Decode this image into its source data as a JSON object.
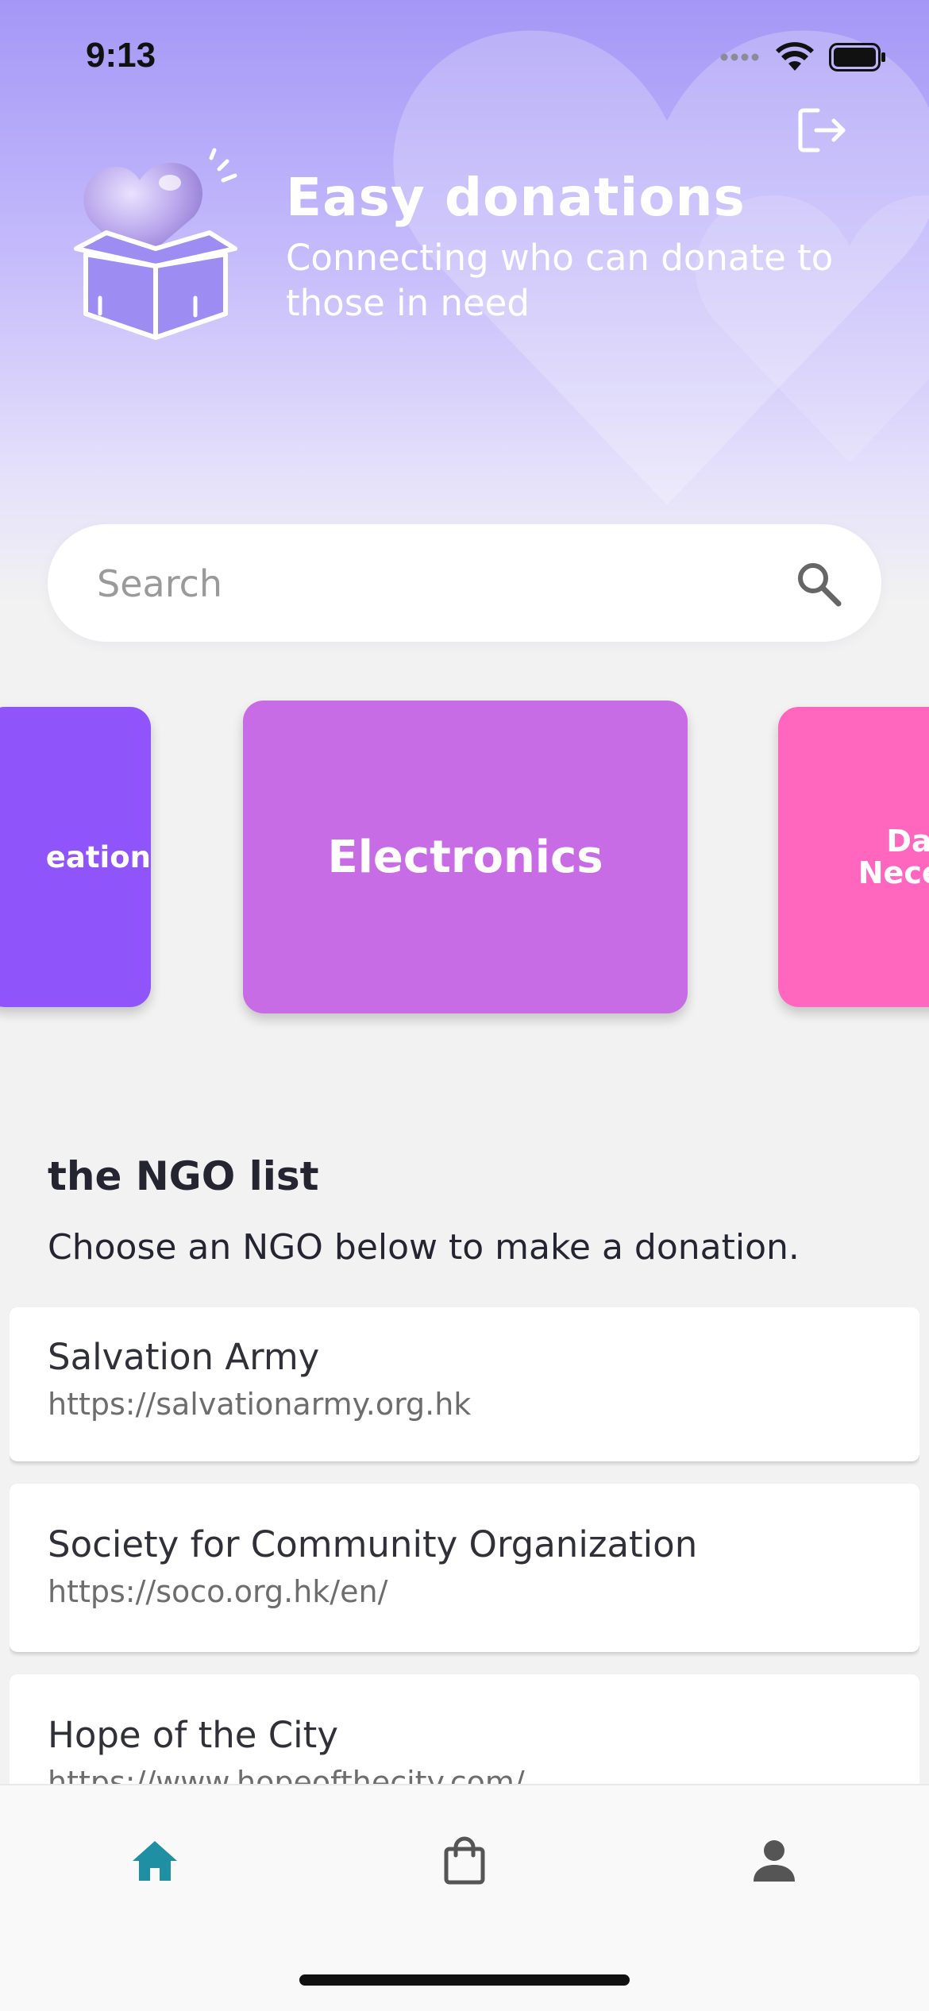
{
  "status_bar": {
    "time": "9:13"
  },
  "header": {
    "title": "Easy donations",
    "subtitle": "Connecting who can donate to those in need",
    "logout_icon": "logout-icon",
    "logo_icon": "heart-in-box-logo"
  },
  "search": {
    "placeholder": "Search",
    "value": "",
    "icon": "search-icon"
  },
  "categories": [
    {
      "label": "Education",
      "visible_text": "eation",
      "color": "#8f55fb"
    },
    {
      "label": "Electronics",
      "visible_text": "Electronics",
      "color": "#c86ce6"
    },
    {
      "label": "Daily Necessities",
      "visible_text": "Da Neces",
      "color": "#ff67bf"
    }
  ],
  "ngo_section": {
    "heading": "the NGO list",
    "instructions": "Choose an NGO below to make a donation.",
    "items": [
      {
        "name": "Salvation Army",
        "url": "https://salvationarmy.org.hk"
      },
      {
        "name": "Society for Community Organization",
        "url": "https://soco.org.hk/en/"
      },
      {
        "name": "Hope of the City",
        "url": "https://www.hopeofthecity.com/"
      }
    ]
  },
  "bottom_nav": {
    "items": [
      {
        "id": "home",
        "icon": "home-icon",
        "active": true
      },
      {
        "id": "donations",
        "icon": "shopping-bag-icon",
        "active": false
      },
      {
        "id": "profile",
        "icon": "person-icon",
        "active": false
      }
    ],
    "active_color": "#1f8fa3",
    "inactive_color": "#555555"
  },
  "colors": {
    "hero_top": "#a497f6",
    "background": "#f2f2f2"
  }
}
